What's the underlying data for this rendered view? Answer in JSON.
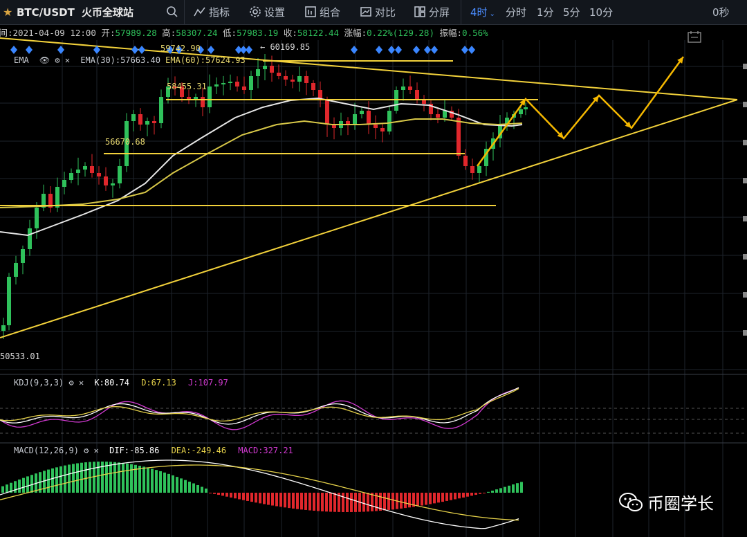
{
  "topbar": {
    "symbol": "BTC/USDT",
    "exchange": "火币全球站",
    "indicators": "指标",
    "settings": "设置",
    "combo": "组合",
    "compare": "对比",
    "split": "分屏",
    "interval_active": "4时",
    "intervals": [
      "分时",
      "1分",
      "5分",
      "10分"
    ],
    "countdown": "0秒"
  },
  "info": {
    "time_label": "时间:",
    "time": "2021-04-09 12:00",
    "open_label": "开:",
    "open": "57989.28",
    "high_label": "高:",
    "high": "58307.24",
    "low_label": "低:",
    "low": "57983.19",
    "close_label": "收:",
    "close": "58122.44",
    "change_label": "涨幅:",
    "change": "0.22%(129.28)",
    "amp_label": "振幅:",
    "amp": "0.56%"
  },
  "ema": {
    "name": "EMA",
    "ema30_label": "EMA(30):",
    "ema30": "57663.40",
    "ema60_label": "EMA(60):",
    "ema60": "57624.93"
  },
  "price_labels": {
    "p59742": "59742.90",
    "p60169": "← 60169.85",
    "p58455": "58455.31",
    "p56670": "56670.68",
    "p50533": "50533.01"
  },
  "kdj": {
    "name": "KDJ(9,3,3)",
    "k": "K:80.74",
    "d": "D:67.13",
    "j": "J:107.97"
  },
  "macd": {
    "name": "MACD(12,26,9)",
    "dif": "DIF:-85.86",
    "dea": "DEA:-249.46",
    "macd": "MACD:327.21"
  },
  "watermark": "币圈学长",
  "colors": {
    "up": "#2fc15b",
    "down": "#e0272c",
    "ema30": "#e6e6e6",
    "ema60": "#d8c848",
    "trend": "#f3d23b",
    "arrow": "#f5b800",
    "k": "#ffffff",
    "d": "#e6d24a",
    "j": "#d23ad2",
    "diamond": "#3a86ff"
  }
}
